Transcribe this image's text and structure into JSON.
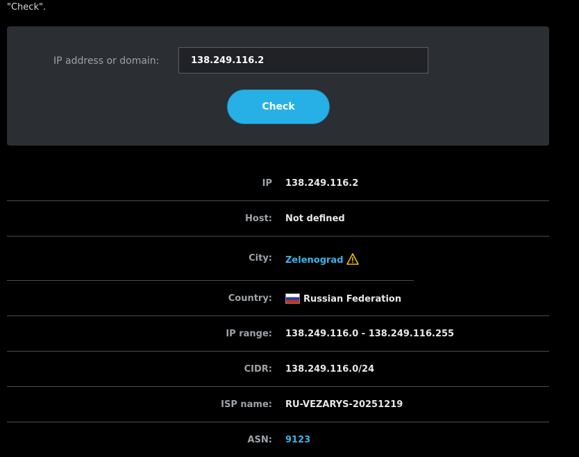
{
  "intro": {
    "trailing_text": "\"Check\"."
  },
  "form": {
    "label": "IP address or domain:",
    "input_value": "138.249.116.2",
    "button_label": "Check"
  },
  "results": {
    "ip": {
      "label": "IP",
      "value": "138.249.116.2"
    },
    "host": {
      "label": "Host:",
      "value": "Not defined"
    },
    "city": {
      "label": "City:",
      "value": "Zelenograd",
      "icon": "warning-icon"
    },
    "country": {
      "label": "Country:",
      "value": "Russian Federation",
      "icon": "russia-flag-icon"
    },
    "ip_range": {
      "label": "IP range:",
      "value": "138.249.116.0 - 138.249.116.255"
    },
    "cidr": {
      "label": "CIDR:",
      "value": "138.249.116.0/24"
    },
    "isp": {
      "label": "ISP name:",
      "value": "RU-VEZARYS-20251219"
    },
    "asn": {
      "label": "ASN:",
      "value": "9123"
    }
  },
  "colors": {
    "accent": "#27b0e6",
    "link": "#39b6e6",
    "panel": "#2b2e33",
    "warning": "#f2c200"
  }
}
